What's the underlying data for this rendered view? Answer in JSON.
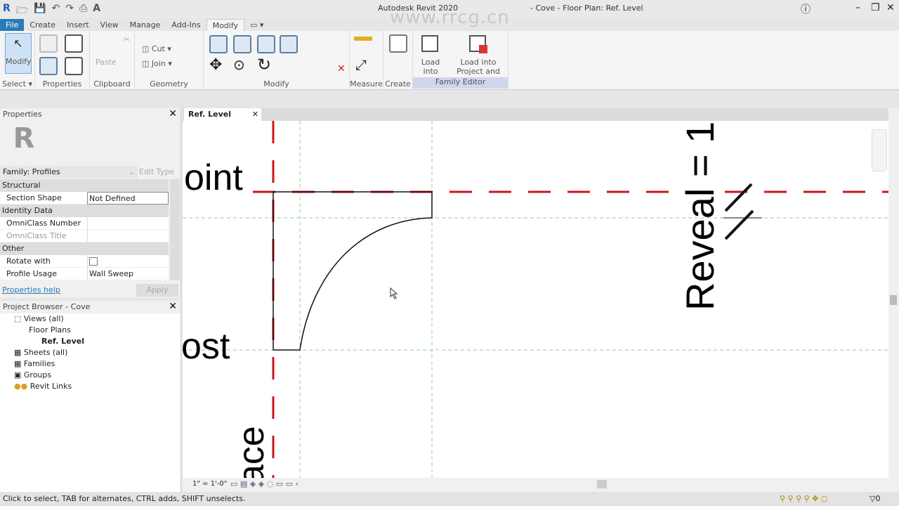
{
  "title": {
    "app": "Autodesk Revit 2020",
    "doc": "- Cove - Floor Plan: Ref. Level",
    "watermark": "www.rrcg.cn"
  },
  "tabs": [
    "File",
    "Create",
    "Insert",
    "View",
    "Manage",
    "Add-Ins",
    "Modify"
  ],
  "ribbon": {
    "modify_btn": "Modify",
    "select": "Select ▾",
    "properties": "Properties",
    "clipboard": "Clipboard",
    "paste": "Paste",
    "cut": "Cut",
    "join": "Join",
    "geometry": "Geometry",
    "modify": "Modify",
    "measure": "Measure",
    "create": "Create",
    "load_project": "Load into Project",
    "load_close": "Load into Project and Close",
    "family_editor": "Family Editor"
  },
  "properties": {
    "title": "Properties",
    "type_selector": "Family: Profiles",
    "edit_type": "Edit Type",
    "groups": [
      {
        "name": "Structural",
        "rows": [
          {
            "k": "Section Shape",
            "v": "Not Defined"
          }
        ]
      },
      {
        "name": "Identity Data",
        "rows": [
          {
            "k": "OmniClass Number",
            "v": ""
          },
          {
            "k": "OmniClass Title",
            "v": ""
          }
        ]
      },
      {
        "name": "Other",
        "rows": [
          {
            "k": "Rotate with component",
            "v": ""
          },
          {
            "k": "Profile Usage",
            "v": "Wall Sweep"
          }
        ]
      }
    ],
    "help": "Properties help",
    "apply": "Apply"
  },
  "browser": {
    "title": "Project Browser - Cove",
    "items": [
      "Views (all)",
      "Floor Plans",
      "Ref. Level",
      "Sheets (all)",
      "Families",
      "Groups",
      "Revit Links"
    ]
  },
  "view": {
    "tab": "Ref. Level",
    "scale": "1\" = 1'-0\"",
    "labels": [
      "oint",
      "ost",
      "ace",
      "Reveal = 1"
    ]
  },
  "status": {
    "text": "Click to select, TAB for alternates, CTRL adds, SHIFT unselects.",
    "filter_count": "0"
  },
  "colors": {
    "ref_plane": "#d0141c",
    "guide": "#8fd18f",
    "file_tab": "#2a7ab8"
  }
}
